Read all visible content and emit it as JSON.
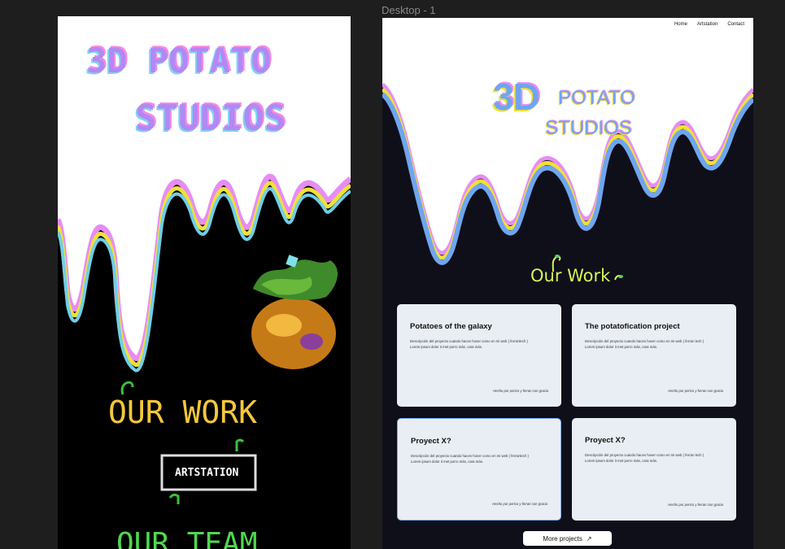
{
  "canvas": {
    "frame_label": "Desktop - 1"
  },
  "sketch": {
    "line1": "3D POTATO",
    "line2": "STUDIOS",
    "our_work": "OUR WORK",
    "artstation": "ARTSTATION",
    "our_team": "OUR TEAM"
  },
  "desktop": {
    "nav": [
      "Home",
      "Artstation",
      "Contact"
    ],
    "logo": {
      "big": "3D",
      "top": "POTATO",
      "bottom": "STUDIOS"
    },
    "section_title": "Our Work",
    "cards": [
      {
        "title": "Potatoes of the galaxy",
        "desc1": "Descripción del proyecto cuando haces hover como en mi web ( ferranlech )",
        "desc2": "Lorem ipsum dolor it met porro más, cara más.",
        "credit": "Hecho por perico y ferran con gracia"
      },
      {
        "title": "The potatofication project",
        "desc1": "Descripción del proyecto cuando haces hover como en mi web ( ferran lech )",
        "desc2": "Lorem ipsum dolor it met porro más, cara más.",
        "credit": "Hecho por perico y ferran con gracia"
      },
      {
        "title": "Proyect X?",
        "desc1": "Descripción del proyecto cuando haces hover como en mi web ( ferranlech )",
        "desc2": "Lorem ipsum dolor it met porro más, cara más.",
        "credit": "Hecho por perico y ferran con gracia"
      },
      {
        "title": "Proyect X?",
        "desc1": "Descripción del proyecto cuando haces hover como en mi web ( ferran lech )",
        "desc2": "Lorem ipsum dolor it met porro más, cara más.",
        "credit": "Hecho por perico y ferran con gracia"
      }
    ],
    "more_button": "More projects",
    "more_icon": "↗"
  },
  "colors": {
    "blue": "#6fa5f0",
    "yellow": "#f0e03a",
    "pink": "#e78cf5",
    "lime": "#d8f35a",
    "dark": "#0f0f1a"
  }
}
